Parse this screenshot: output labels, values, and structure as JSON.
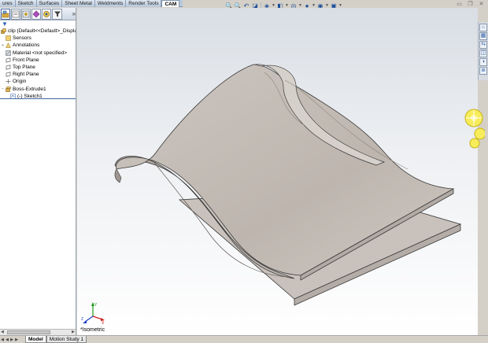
{
  "command_tabs": [
    {
      "label": "ures",
      "active": false
    },
    {
      "label": "Sketch",
      "active": false
    },
    {
      "label": "Surfaces",
      "active": false
    },
    {
      "label": "Sheet Metal",
      "active": false
    },
    {
      "label": "Weldments",
      "active": false
    },
    {
      "label": "Render Tools",
      "active": false
    },
    {
      "label": "CAM",
      "active": true
    }
  ],
  "feature_tree": {
    "root": "clip  (Default<<Default>_Display",
    "items": [
      {
        "label": "Sensors",
        "icon": "sensors-icon"
      },
      {
        "label": "Annotations",
        "icon": "annotations-icon"
      },
      {
        "label": "Material <not specified>",
        "icon": "material-icon"
      },
      {
        "label": "Front Plane",
        "icon": "plane-icon"
      },
      {
        "label": "Top Plane",
        "icon": "plane-icon"
      },
      {
        "label": "Right Plane",
        "icon": "plane-icon"
      },
      {
        "label": "Origin",
        "icon": "origin-icon"
      },
      {
        "label": "Boss-Extrude1",
        "icon": "extrude-icon"
      },
      {
        "label": "(-) Sketch1",
        "icon": "sketch-icon"
      }
    ]
  },
  "view": {
    "orientation_label": "*Isometric",
    "triad": {
      "x": "X",
      "y": "Y",
      "z": "Z"
    }
  },
  "bottom_tabs": [
    {
      "label": "Model",
      "active": true
    },
    {
      "label": "Motion Study 1",
      "active": false
    }
  ],
  "colors": {
    "part_face": "#c9c2bc",
    "part_edge": "#3a3a3a",
    "selection_blue": "#3d66a8"
  }
}
